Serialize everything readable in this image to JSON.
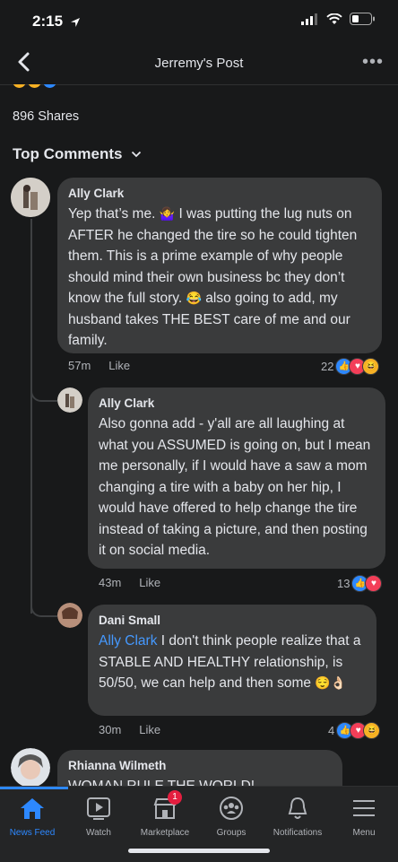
{
  "status": {
    "time": "2:15"
  },
  "header": {
    "title": "Jerremy's Post"
  },
  "post": {
    "shares": "896 Shares",
    "sort_label": "Top Comments"
  },
  "comments": [
    {
      "author": "Ally Clark",
      "text_parts": [
        "Yep that’s me.",
        "I was putting the lug nuts on AFTER he changed the tire so he could tighten them. This is a prime example of why people should mind their own business bc they don’t know the full story.",
        "also going to add, my husband takes THE BEST care of me and our family."
      ],
      "time": "57m",
      "like_label": "Like",
      "reaction_count": "22"
    },
    {
      "author": "Ally Clark",
      "text": "Also gonna add - y'all are all laughing at what you ASSUMED is going on, but I mean me personally, if I would have a saw a mom changing a tire with a baby on her hip, I would have offered to help change the tire instead of taking a picture, and then posting it on social media.",
      "time": "43m",
      "like_label": "Like",
      "reaction_count": "13"
    },
    {
      "author": "Dani Small",
      "mention": "Ally Clark",
      "text": " I don't think people realize that a STABLE AND HEALTHY relationship, is 50/50, we can help and then some",
      "time": "30m",
      "like_label": "Like",
      "reaction_count": "4"
    },
    {
      "author": "Rhianna Wilmeth",
      "text": "WOMAN RULE THE WORLD!"
    }
  ],
  "tabs": [
    {
      "label": "News Feed",
      "icon": "home-icon",
      "active": true
    },
    {
      "label": "Watch",
      "icon": "watch-icon"
    },
    {
      "label": "Marketplace",
      "icon": "marketplace-icon",
      "badge": "1"
    },
    {
      "label": "Groups",
      "icon": "groups-icon"
    },
    {
      "label": "Notifications",
      "icon": "bell-icon"
    },
    {
      "label": "Menu",
      "icon": "menu-icon"
    }
  ],
  "colors": {
    "accent": "#2d88ff",
    "background": "#18191a",
    "bubble": "#3a3b3c",
    "badge": "#e41e3f"
  }
}
